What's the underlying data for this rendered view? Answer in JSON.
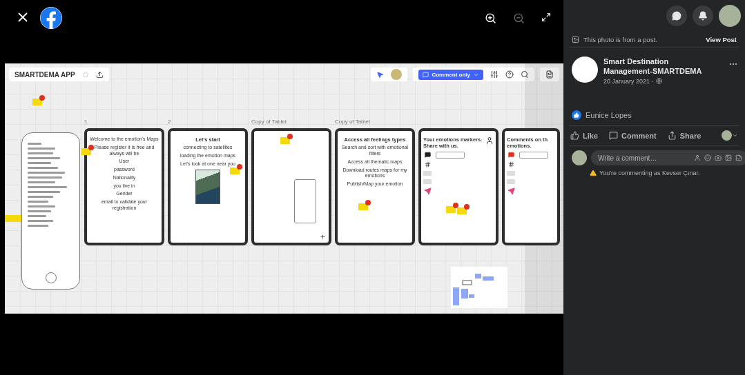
{
  "board": {
    "title": "SMARTDEMA APP",
    "mode_button": "Comment only",
    "frames": [
      {
        "label": "1",
        "kind": "form",
        "lines": [
          "Welcome to the emotion's Maps",
          "Please register it is free and always will be",
          "User",
          "password",
          "Nationality",
          "you live in",
          "Gender",
          "email to validate your registration"
        ]
      },
      {
        "label": "2",
        "kind": "map",
        "lines": [
          "Let's start",
          "connecting to satellites",
          "loading the emotion maps",
          "Let's look at one near you"
        ]
      },
      {
        "label": "Copy of Tablet",
        "kind": "phone"
      },
      {
        "label": "Copy of Tablet",
        "kind": "menu",
        "lines": [
          "Access all feelings types",
          "Search and sort with emotional filters",
          "Access all thematic maps",
          "Download routes maps for my emotions",
          "Publish/Map your emotion"
        ]
      },
      {
        "kind": "markers",
        "lines": [
          "Your emotions markers.",
          "Share with us."
        ]
      },
      {
        "kind": "comments",
        "lines": [
          "Comments on th",
          "emotions."
        ]
      }
    ]
  },
  "post": {
    "notice": "This photo is from a post.",
    "view_post": "View Post",
    "page_name": "Smart Destination Management-SMARTDEMA",
    "date": "20 January 2021 ·",
    "reactor": "Eunice Lopes",
    "actions": [
      {
        "kind": "like",
        "label": "Like"
      },
      {
        "kind": "comment",
        "label": "Comment"
      },
      {
        "kind": "share",
        "label": "Share"
      }
    ],
    "comment_placeholder": "Write a comment…",
    "warning": "You're commenting as Kevser Çınar."
  }
}
